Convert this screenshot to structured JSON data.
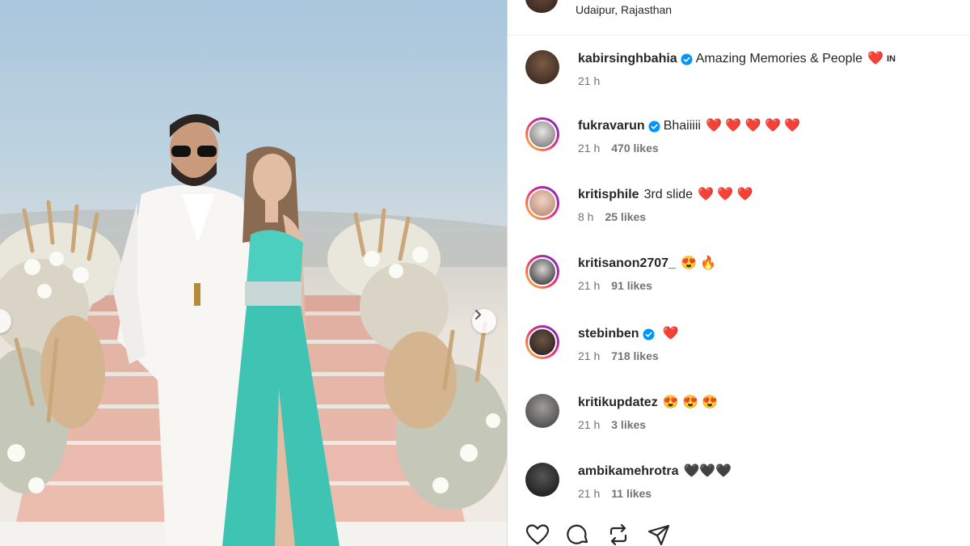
{
  "post": {
    "location": "Udaipur, Rajasthan",
    "colors": {
      "verified": "#0095f6",
      "heart": "#ff2e63",
      "ring_start": "#f9ce34",
      "ring_end": "#6228d7"
    }
  },
  "comments": [
    {
      "user": "kabirsinghbahia",
      "verified": true,
      "text": "Amazing Memories & People",
      "emoji": "❤️",
      "badge": "IN",
      "time": "21 h",
      "likes": ""
    },
    {
      "user": "fukravarun",
      "verified": true,
      "text": "Bhaiiiii",
      "emoji": "❤️ ❤️ ❤️ ❤️ ❤️",
      "badge": "",
      "time": "21 h",
      "likes": "470 likes"
    },
    {
      "user": "kritisphile",
      "verified": false,
      "text": "3rd slide",
      "emoji": "❤️ ❤️ ❤️",
      "badge": "",
      "time": "8 h",
      "likes": "25 likes"
    },
    {
      "user": "kritisanon2707_",
      "verified": false,
      "text": "",
      "emoji": "😍 🔥",
      "badge": "",
      "time": "21 h",
      "likes": "91 likes"
    },
    {
      "user": "stebinben",
      "verified": true,
      "text": "",
      "emoji": "❤️",
      "badge": "",
      "time": "21 h",
      "likes": "718 likes"
    },
    {
      "user": "kritikupdatez",
      "verified": false,
      "text": "",
      "emoji": "😍 😍 😍",
      "badge": "",
      "time": "21 h",
      "likes": "3 likes"
    },
    {
      "user": "ambikamehrotra",
      "verified": false,
      "text": "",
      "emoji": "🖤🖤🖤",
      "badge": "",
      "time": "21 h",
      "likes": "11 likes"
    }
  ],
  "actions": [
    "heart-icon",
    "comment-icon",
    "repost-icon",
    "share-icon"
  ],
  "photo": {
    "carousel_next": "chevron-right-icon"
  }
}
